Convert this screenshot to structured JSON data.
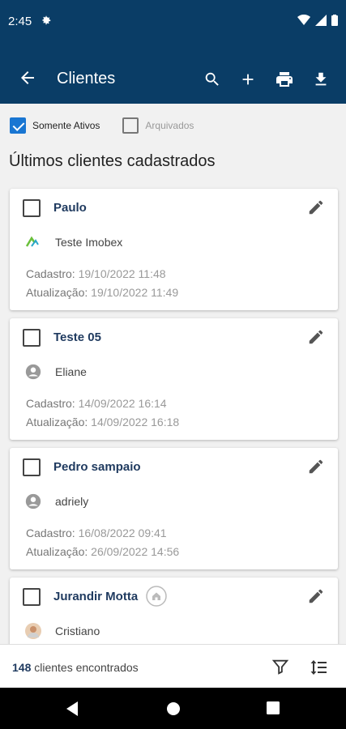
{
  "status": {
    "time": "2:45"
  },
  "appbar": {
    "title": "Clientes"
  },
  "filters": {
    "active_label": "Somente Ativos",
    "archived_label": "Arquivados"
  },
  "heading": "Últimos clientes cadastrados",
  "labels": {
    "cadastro": "Cadastro:",
    "atualizacao": "Atualização:"
  },
  "clients": [
    {
      "name": "Paulo",
      "owner": "Teste Imobex",
      "cadastro": "19/10/2022 11:48",
      "atualizacao": "19/10/2022 11:49"
    },
    {
      "name": "Teste 05",
      "owner": "Eliane",
      "cadastro": "14/09/2022 16:14",
      "atualizacao": "14/09/2022 16:18"
    },
    {
      "name": "Pedro sampaio",
      "owner": "adriely",
      "cadastro": "16/08/2022 09:41",
      "atualizacao": "26/09/2022 14:56"
    },
    {
      "name": "Jurandir Motta",
      "owner": "Cristiano"
    }
  ],
  "footer": {
    "count": "148",
    "count_label": "clientes encontrados"
  },
  "colors": {
    "primary": "#0a3d66",
    "accent": "#1976d2",
    "name": "#1f3a5f"
  }
}
